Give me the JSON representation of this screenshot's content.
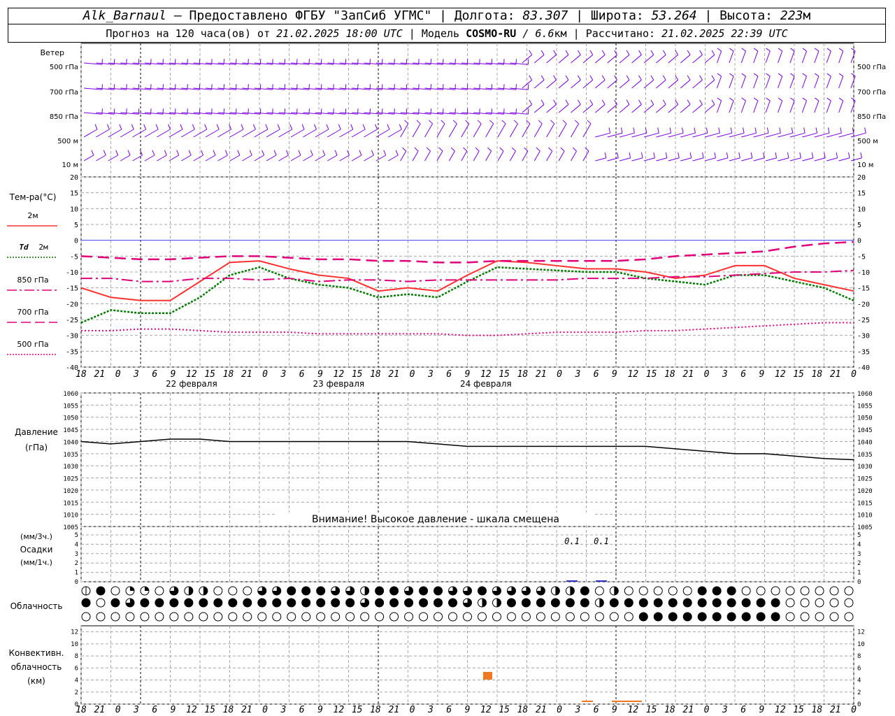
{
  "header": {
    "station": "Alk_Barnaul",
    "dash": "—",
    "provider": "Предоставлено ФГБУ \"ЗапСиб УГМС\"",
    "lon_label": "Долгота:",
    "lon": "83.307",
    "lat_label": "Широта:",
    "lat": "53.264",
    "alt_label": "Высота:",
    "alt": "223",
    "alt_unit": "м",
    "forecast_label": "Прогноз на 120 часа(ов) от",
    "forecast_from": "21.02.2025 18:00 UTC",
    "model_label": "Модель",
    "model": "COSMO-RU",
    "resolution": "/ 6.6",
    "resolution_unit": "км",
    "calc_label": "Рассчитано:",
    "calc_time": "21.02.2025 22:39 UTC"
  },
  "colors": {
    "wind": "#7a00e0",
    "t2m": "#ff3030",
    "td2m": "#007a00",
    "t850": "#e0007a",
    "t700": "#e0007a",
    "t500": "#e0007a",
    "pressure": "#000000",
    "convective": "#f07820",
    "grid": "#a8a8a8",
    "zero_line": "#4040ff"
  },
  "panels": {
    "wind": {
      "title": "Ветер",
      "levels": [
        "500 гПа",
        "700 гПа",
        "850 гПа",
        "500 м",
        "10  м"
      ]
    },
    "temperature": {
      "title": "Тем-ра(°C)",
      "legend": [
        {
          "label": "2м",
          "style": "solid"
        },
        {
          "label": "2м",
          "prefix": "Td",
          "style": "dotted"
        },
        {
          "label": "850 гПа",
          "style": "dashdot"
        },
        {
          "label": "700 гПа",
          "style": "dash"
        },
        {
          "label": "500 гПа",
          "style": "fine-dotted"
        }
      ],
      "ticks": [
        "20",
        "15",
        "10",
        "5",
        "0",
        "-5",
        "-10",
        "-15",
        "-20",
        "-25",
        "-30",
        "-35",
        "-40"
      ]
    },
    "pressure": {
      "title": "Давление",
      "unit": "(гПа)",
      "warning": "Внимание! Высокое давление - шкала смещена",
      "ticks": [
        "1060",
        "1055",
        "1050",
        "1045",
        "1040",
        "1035",
        "1030",
        "1025",
        "1020",
        "1015",
        "1010",
        "1005"
      ]
    },
    "precip": {
      "unit3h": "(мм/3ч.)",
      "title": "Осадки",
      "unit1h": "(мм/1ч.)",
      "ticks": [
        "5",
        "4",
        "3",
        "2",
        "1",
        "0"
      ],
      "annotations": [
        "0.1",
        "0.1"
      ]
    },
    "cloud": {
      "title": "Облачность"
    },
    "convective": {
      "title1": "Конвективн.",
      "title2": "облачность",
      "unit": "(км)",
      "ticks": [
        "12",
        "10",
        "8",
        "6",
        "4",
        "2",
        "0"
      ]
    }
  },
  "time_axis": {
    "hour_labels": [
      "18",
      "21",
      "0",
      "3",
      "6",
      "9",
      "12",
      "15",
      "18",
      "21",
      "0",
      "3",
      "6",
      "9",
      "12",
      "15",
      "18",
      "21",
      "0",
      "3",
      "6",
      "9",
      "12",
      "15",
      "18",
      "21",
      "0",
      "3",
      "6",
      "9",
      "12",
      "15",
      "18",
      "21",
      "0",
      "3",
      "6",
      "9",
      "12",
      "15",
      "18",
      "21",
      "0"
    ],
    "dates": [
      "22 февраля",
      "23 февраля",
      "24 февраля"
    ]
  },
  "chart_data": [
    {
      "type": "line",
      "name": "temperature",
      "x_hours": [
        0,
        3,
        6,
        9,
        12,
        15,
        18,
        21,
        24,
        27,
        30,
        33,
        36,
        39,
        42,
        45,
        48,
        51,
        54,
        57,
        60,
        63,
        66,
        69,
        72,
        75,
        78
      ],
      "ylim": [
        -40,
        20
      ],
      "series": [
        {
          "name": "2м",
          "values": [
            -15,
            -18,
            -19,
            -19,
            -13,
            -7,
            -6.5,
            -9,
            -11,
            -12,
            -16,
            -15,
            -16,
            -11,
            -6.5,
            -7,
            -8,
            -9,
            -9,
            -10,
            -12,
            -11,
            -8,
            -8,
            -12,
            -14,
            -16
          ]
        },
        {
          "name": "Td 2м",
          "values": [
            -26,
            -22,
            -23,
            -23,
            -18,
            -11,
            -8.5,
            -12,
            -14,
            -15,
            -18,
            -17,
            -18,
            -13,
            -8.5,
            -9,
            -9.5,
            -10,
            -10,
            -12,
            -13,
            -14,
            -11,
            -11,
            -13,
            -15,
            -19
          ]
        },
        {
          "name": "850 гПа",
          "values": [
            -12,
            -12,
            -13,
            -13,
            -12,
            -12,
            -12.5,
            -12,
            -13,
            -12.5,
            -12.5,
            -13,
            -12.5,
            -12.5,
            -12.5,
            -12.5,
            -12.5,
            -12,
            -12,
            -12,
            -11.5,
            -11.5,
            -11,
            -10.5,
            -10,
            -10,
            -9.5
          ]
        },
        {
          "name": "700 гПа",
          "values": [
            -5,
            -5.5,
            -6,
            -6,
            -5.5,
            -5,
            -5,
            -5.5,
            -6,
            -6,
            -6.5,
            -6.5,
            -7,
            -7,
            -6.5,
            -6.5,
            -6.5,
            -6.5,
            -6.5,
            -6,
            -5,
            -4.5,
            -4,
            -3.5,
            -2,
            -1,
            -0.5
          ]
        },
        {
          "name": "500 гПа",
          "values": [
            -28.5,
            -28.5,
            -28,
            -28,
            -28.5,
            -29,
            -29,
            -29,
            -29.5,
            -29.5,
            -29.5,
            -29.5,
            -29.5,
            -30,
            -30,
            -29.5,
            -29,
            -29,
            -29,
            -28.5,
            -28.5,
            -28,
            -27.5,
            -27,
            -26.5,
            -26,
            -26
          ]
        }
      ]
    },
    {
      "type": "line",
      "name": "pressure",
      "x_hours": [
        0,
        3,
        6,
        9,
        12,
        15,
        18,
        21,
        24,
        27,
        30,
        33,
        36,
        39,
        42,
        45,
        48,
        51,
        54,
        57,
        60,
        63,
        66,
        69,
        72,
        75,
        78
      ],
      "ylim": [
        1005,
        1060
      ],
      "series": [
        {
          "name": "Давление",
          "values": [
            1040,
            1039,
            1040,
            1041,
            1041,
            1040,
            1040,
            1040,
            1040,
            1040,
            1040,
            1040,
            1039,
            1038,
            1038,
            1038,
            1038,
            1038,
            1038,
            1038,
            1037,
            1036,
            1035,
            1035,
            1034,
            1033,
            1032.5
          ]
        }
      ]
    },
    {
      "type": "bar",
      "name": "precipitation",
      "x_hours": [
        56,
        63
      ],
      "values": [
        0.1,
        0.1
      ],
      "ylim": [
        0,
        5
      ]
    },
    {
      "type": "bar",
      "name": "convective_cloud",
      "x_hours": [
        40
      ],
      "values": [
        5
      ],
      "ylim": [
        0,
        13
      ]
    }
  ],
  "cloud_rows": [
    "pf0qq34hh00044fff44hff4ff44f4444hhf0h00000fff0000000000000000000",
    "f0f4fffffffffffffff4ffffff4hhffffffhffffffffffff0000000000000000",
    "00000000000000000000000000000000000000ffffffffff00000000000000000"
  ]
}
